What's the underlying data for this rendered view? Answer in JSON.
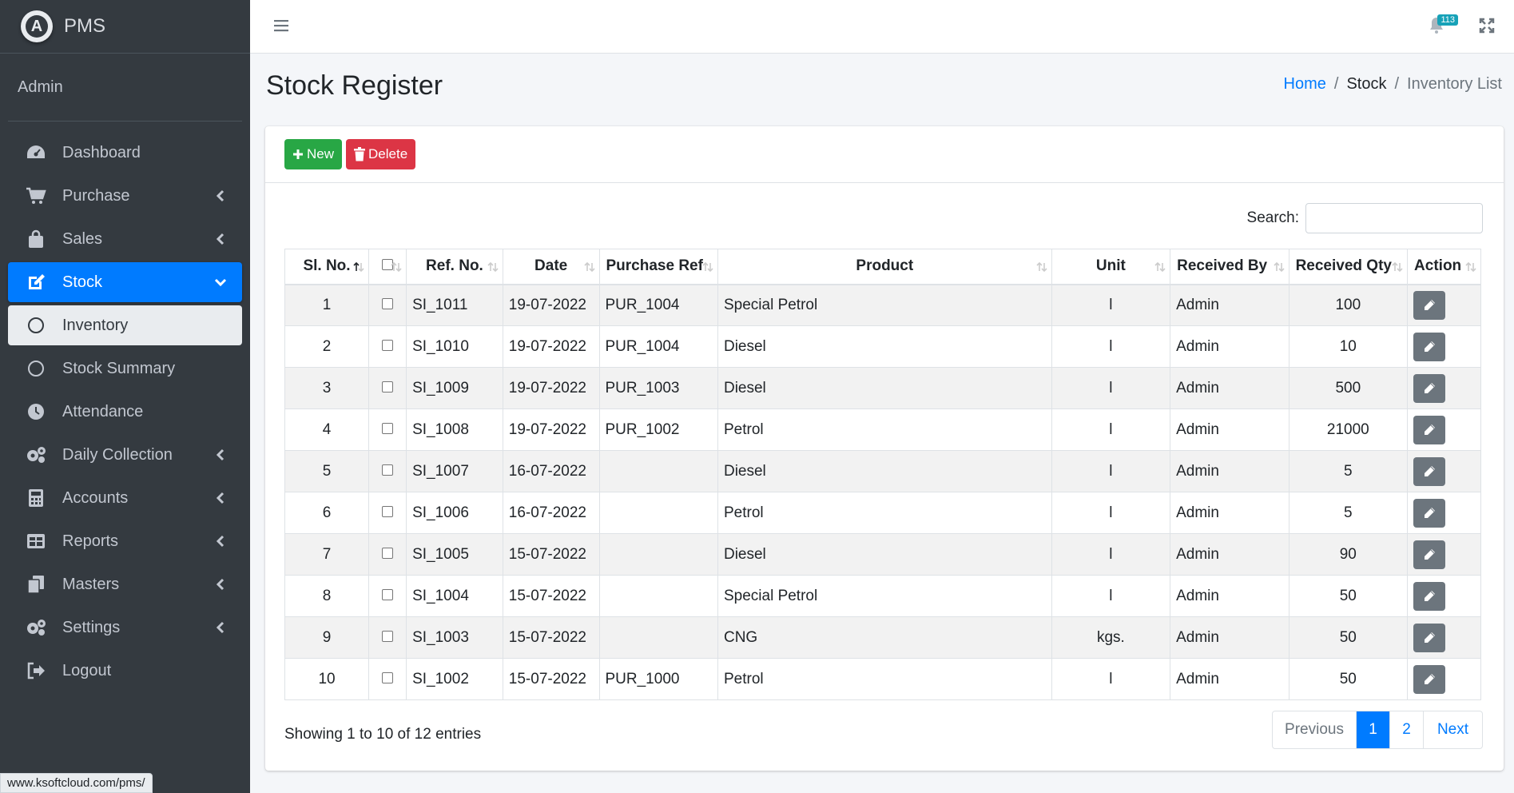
{
  "brand": {
    "logo_letter": "A",
    "name": "PMS"
  },
  "user": {
    "name": "Admin"
  },
  "sidebar": {
    "items": [
      {
        "label": "Dashboard"
      },
      {
        "label": "Purchase"
      },
      {
        "label": "Sales"
      },
      {
        "label": "Stock"
      },
      {
        "label": "Inventory"
      },
      {
        "label": "Stock Summary"
      },
      {
        "label": "Attendance"
      },
      {
        "label": "Daily Collection"
      },
      {
        "label": "Accounts"
      },
      {
        "label": "Reports"
      },
      {
        "label": "Masters"
      },
      {
        "label": "Settings"
      },
      {
        "label": "Logout"
      }
    ]
  },
  "status_url": "www.ksoftcloud.com/pms/",
  "topbar": {
    "notification_count": "113"
  },
  "page": {
    "title": "Stock Register"
  },
  "breadcrumb": {
    "home": "Home",
    "sep": "/",
    "stock": "Stock",
    "current": "Inventory List"
  },
  "toolbar": {
    "new_label": "New",
    "delete_label": "Delete"
  },
  "search": {
    "label": "Search:",
    "value": ""
  },
  "table": {
    "headers": {
      "slno": "Sl. No.",
      "ref": "Ref. No.",
      "date": "Date",
      "purchase_ref": "Purchase Ref",
      "product": "Product",
      "unit": "Unit",
      "received_by": "Received By",
      "received_qty": "Received Qty",
      "action": "Action"
    },
    "rows": [
      {
        "slno": "1",
        "ref": "SI_1011",
        "date": "19-07-2022",
        "purchase_ref": "PUR_1004",
        "product": "Special Petrol",
        "unit": "l",
        "received_by": "Admin",
        "received_qty": "100"
      },
      {
        "slno": "2",
        "ref": "SI_1010",
        "date": "19-07-2022",
        "purchase_ref": "PUR_1004",
        "product": "Diesel",
        "unit": "l",
        "received_by": "Admin",
        "received_qty": "10"
      },
      {
        "slno": "3",
        "ref": "SI_1009",
        "date": "19-07-2022",
        "purchase_ref": "PUR_1003",
        "product": "Diesel",
        "unit": "l",
        "received_by": "Admin",
        "received_qty": "500"
      },
      {
        "slno": "4",
        "ref": "SI_1008",
        "date": "19-07-2022",
        "purchase_ref": "PUR_1002",
        "product": "Petrol",
        "unit": "l",
        "received_by": "Admin",
        "received_qty": "21000"
      },
      {
        "slno": "5",
        "ref": "SI_1007",
        "date": "16-07-2022",
        "purchase_ref": "",
        "product": "Diesel",
        "unit": "l",
        "received_by": "Admin",
        "received_qty": "5"
      },
      {
        "slno": "6",
        "ref": "SI_1006",
        "date": "16-07-2022",
        "purchase_ref": "",
        "product": "Petrol",
        "unit": "l",
        "received_by": "Admin",
        "received_qty": "5"
      },
      {
        "slno": "7",
        "ref": "SI_1005",
        "date": "15-07-2022",
        "purchase_ref": "",
        "product": "Diesel",
        "unit": "l",
        "received_by": "Admin",
        "received_qty": "90"
      },
      {
        "slno": "8",
        "ref": "SI_1004",
        "date": "15-07-2022",
        "purchase_ref": "",
        "product": "Special Petrol",
        "unit": "l",
        "received_by": "Admin",
        "received_qty": "50"
      },
      {
        "slno": "9",
        "ref": "SI_1003",
        "date": "15-07-2022",
        "purchase_ref": "",
        "product": "CNG",
        "unit": "kgs.",
        "received_by": "Admin",
        "received_qty": "50"
      },
      {
        "slno": "10",
        "ref": "SI_1002",
        "date": "15-07-2022",
        "purchase_ref": "PUR_1000",
        "product": "Petrol",
        "unit": "l",
        "received_by": "Admin",
        "received_qty": "50"
      }
    ]
  },
  "footer": {
    "info": "Showing 1 to 10 of 12 entries"
  },
  "pagination": {
    "previous": "Previous",
    "page1": "1",
    "page2": "2",
    "next": "Next"
  },
  "colors": {
    "sidebar_bg": "#343a40",
    "accent": "#007bff",
    "success": "#28a745",
    "danger": "#dc3545"
  }
}
